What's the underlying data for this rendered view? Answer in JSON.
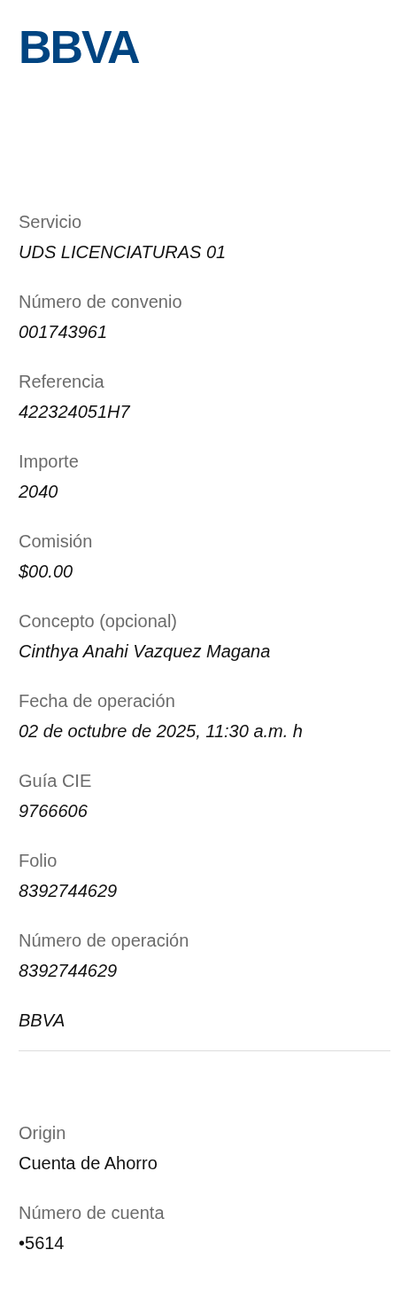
{
  "logo": "BBVA",
  "details": [
    {
      "label": "Servicio",
      "value": "UDS LICENCIATURAS 01"
    },
    {
      "label": "Número de convenio",
      "value": "001743961"
    },
    {
      "label": "Referencia",
      "value": "422324051H7"
    },
    {
      "label": "Importe",
      "value": "2040"
    },
    {
      "label": "Comisión",
      "value": "$00.00"
    },
    {
      "label": "Concepto (opcional)",
      "value": "Cinthya Anahi Vazquez Magana"
    },
    {
      "label": "Fecha de operación",
      "value": "02 de octubre de 2025, 11:30 a.m. h"
    },
    {
      "label": "Guía CIE",
      "value": "9766606"
    },
    {
      "label": "Folio",
      "value": "8392744629"
    },
    {
      "label": "Número de operación",
      "value": "8392744629"
    }
  ],
  "bank": "BBVA",
  "origin": [
    {
      "label": "Origin",
      "value": "Cuenta de Ahorro"
    },
    {
      "label": "Número de cuenta",
      "value": "•5614"
    }
  ]
}
